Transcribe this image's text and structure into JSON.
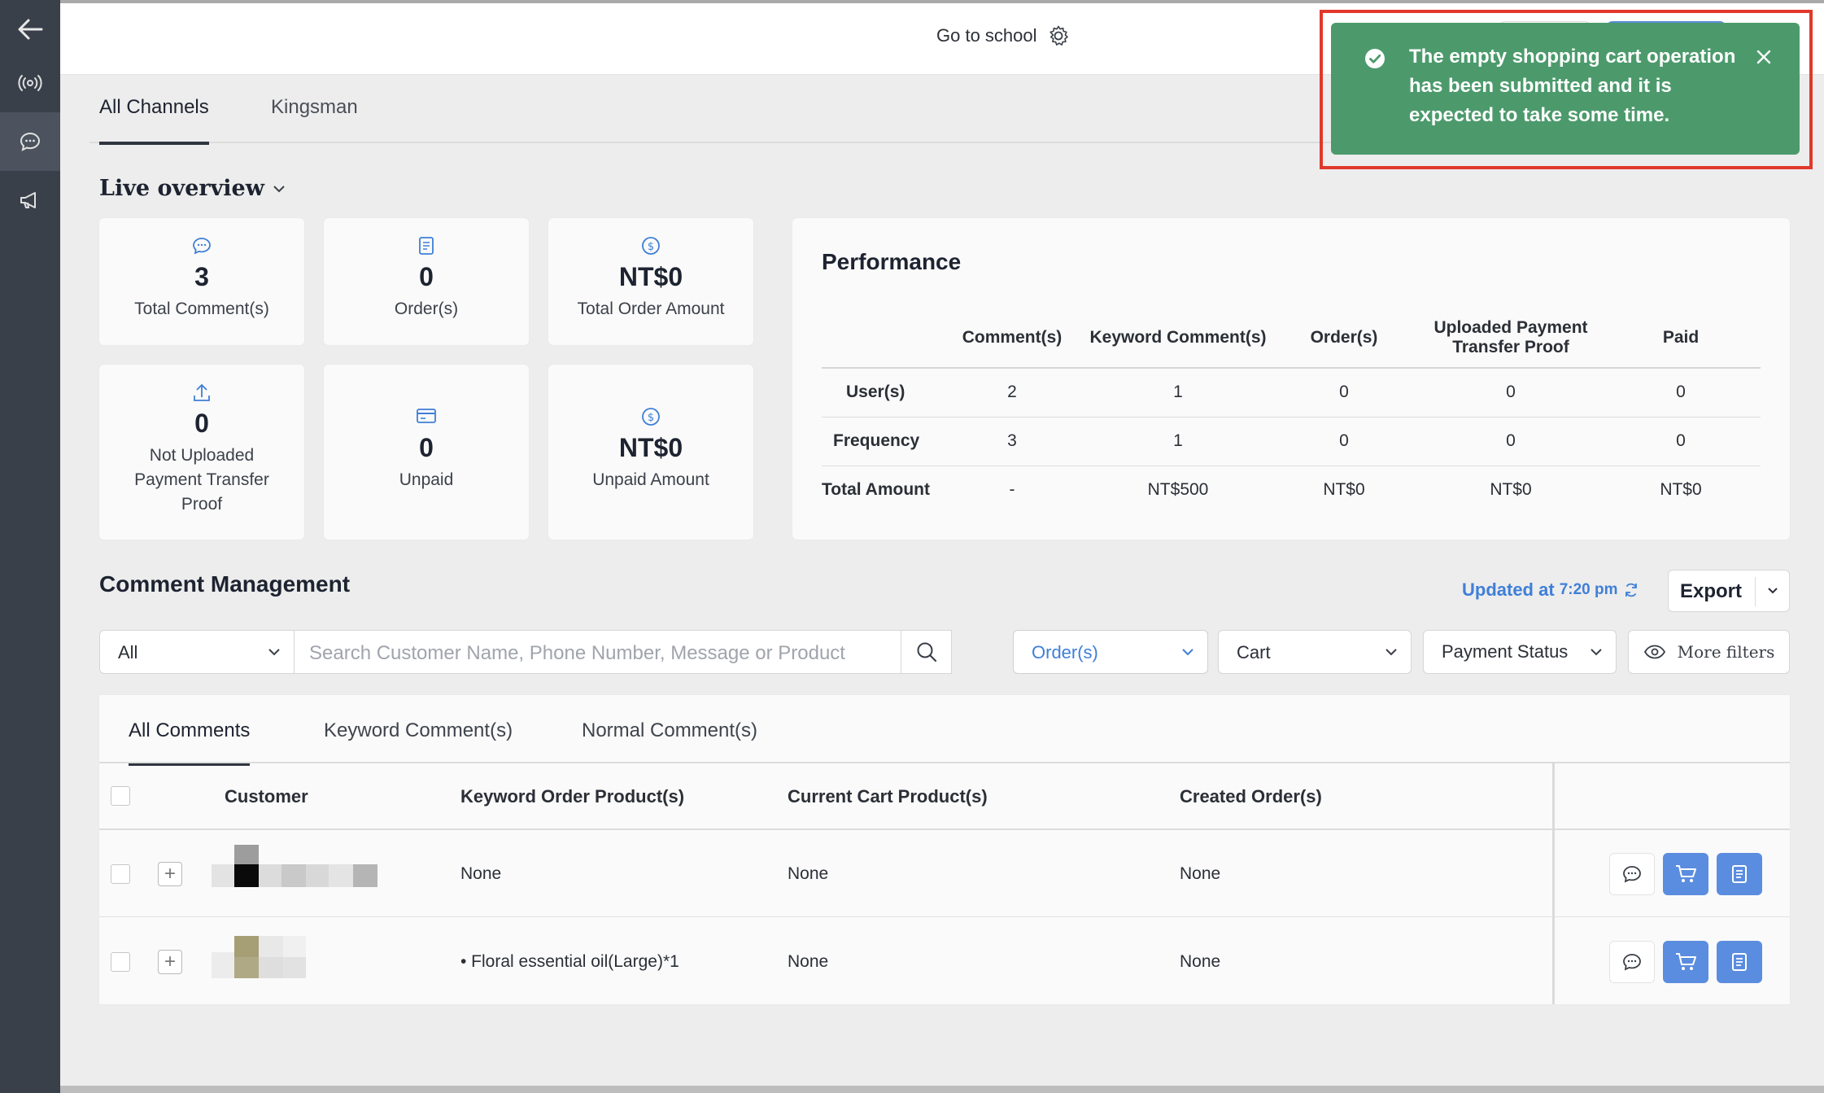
{
  "header": {
    "title": "Go to school"
  },
  "channel_tabs": [
    {
      "label": "All Channels"
    },
    {
      "label": "Kingsman"
    }
  ],
  "live_overview": {
    "title": "Live overview",
    "cards": [
      {
        "icon": "comment-icon",
        "value": "3",
        "label": "Total Comment(s)"
      },
      {
        "icon": "order-icon",
        "value": "0",
        "label": "Order(s)"
      },
      {
        "icon": "dollar-icon",
        "value": "NT$0",
        "label": "Total Order Amount"
      },
      {
        "icon": "upload-icon",
        "value": "0",
        "label": "Not Uploaded Payment Transfer Proof"
      },
      {
        "icon": "card-icon",
        "value": "0",
        "label": "Unpaid"
      },
      {
        "icon": "dollar-icon",
        "value": "NT$0",
        "label": "Unpaid Amount"
      }
    ]
  },
  "performance": {
    "title": "Performance",
    "columns": [
      "Comment(s)",
      "Keyword Comment(s)",
      "Order(s)",
      "Uploaded Payment Transfer Proof",
      "Paid"
    ],
    "rows": [
      {
        "label": "User(s)",
        "values": [
          "2",
          "1",
          "0",
          "0",
          "0"
        ]
      },
      {
        "label": "Frequency",
        "values": [
          "3",
          "1",
          "0",
          "0",
          "0"
        ]
      },
      {
        "label": "Total Amount",
        "values": [
          "-",
          "NT$500",
          "NT$0",
          "NT$0",
          "NT$0"
        ]
      }
    ]
  },
  "comment_management": {
    "title": "Comment Management",
    "updated_prefix": "Updated at",
    "updated_time": "7:20 pm",
    "export_label": "Export",
    "filters": {
      "scope": "All",
      "search_placeholder": "Search Customer Name, Phone Number, Message or Product",
      "orders": "Order(s)",
      "cart": "Cart",
      "payment": "Payment Status",
      "more": "More filters"
    },
    "tabs": [
      {
        "label": "All Comments"
      },
      {
        "label": "Keyword Comment(s)"
      },
      {
        "label": "Normal Comment(s)"
      }
    ],
    "columns": [
      "Customer",
      "Keyword Order Product(s)",
      "Current Cart Product(s)",
      "Created Order(s)"
    ],
    "rows": [
      {
        "keyword": "None",
        "cart": "None",
        "orders": "None"
      },
      {
        "keyword": "• Floral essential oil(Large)*1",
        "cart": "None",
        "orders": "None"
      }
    ]
  },
  "toast": {
    "message": "The empty shopping cart operation has been submitted and it is expected to take some time.",
    "type": "success"
  },
  "colors": {
    "accent": "#3f7fd8",
    "success": "#4c9a6c",
    "sidebar": "#3a404a",
    "highlight": "#e0392b"
  }
}
